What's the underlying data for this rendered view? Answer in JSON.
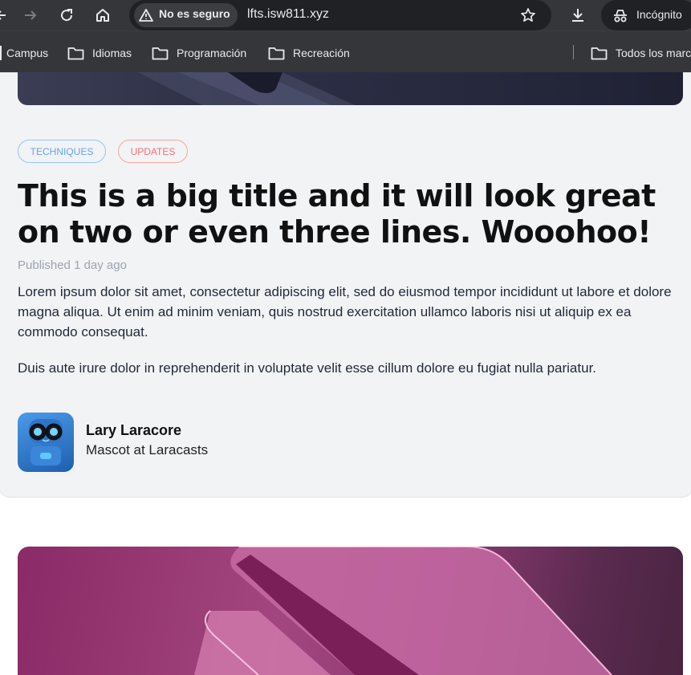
{
  "browser": {
    "security_label": "No es seguro",
    "url": "lfts.isw811.xyz",
    "incognito_label": "Incógnito",
    "bookmarks": [
      "Campus",
      "Idiomas",
      "Programación",
      "Recreación"
    ],
    "all_bookmarks_label": "Todos los marc"
  },
  "post": {
    "tags": [
      "TECHNIQUES",
      "UPDATES"
    ],
    "title": "This is a big title and it will look great on two or even three lines. Wooohoo!",
    "published_prefix": "Published",
    "published_when": "1 day ago",
    "paragraphs": [
      "Lorem ipsum dolor sit amet, consectetur adipiscing elit, sed do eiusmod tempor incididunt ut labore et dolore magna aliqua. Ut enim ad minim veniam, quis nostrud exercitation ullamco laboris nisi ut aliquip ex ea commodo consequat.",
      "Duis aute irure dolor in reprehenderit in voluptate velit esse cillum dolore eu fugiat nulla pariatur."
    ],
    "author": {
      "name": "Lary Laracore",
      "role": "Mascot at Laracasts"
    }
  },
  "colors": {
    "chrome_bg": "#35363a",
    "tag_blue": "#60a5fa",
    "tag_red": "#f87171"
  }
}
